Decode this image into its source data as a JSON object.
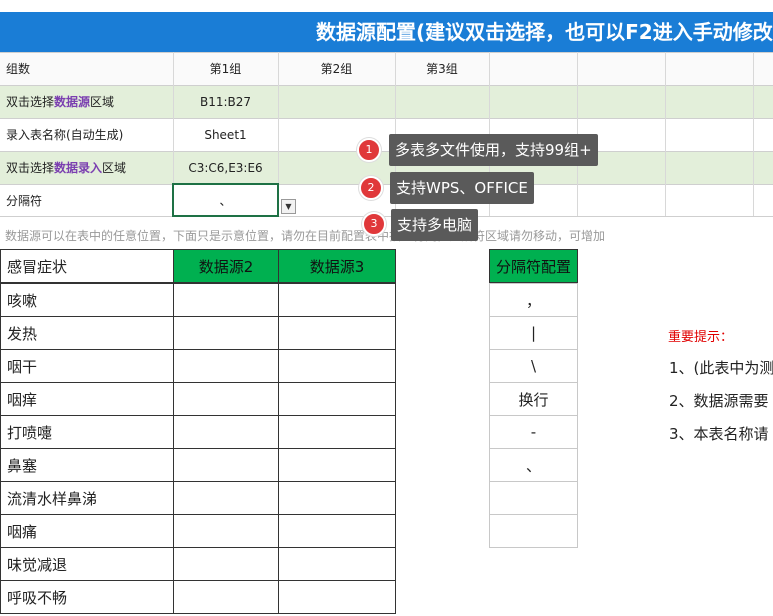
{
  "title": "数据源配置(建议双击选择，也可以F2进入手动修改",
  "config": {
    "header_label": "组数",
    "groups": [
      "第1组",
      "第2组",
      "第3组"
    ],
    "rows": [
      {
        "label_pre": "双击选择",
        "label_em": "数据源",
        "label_post": "区域",
        "value": "B11:B27"
      },
      {
        "label_pre": "录入表名称(自动生成)",
        "label_em": "",
        "label_post": "",
        "value": "Sheet1"
      },
      {
        "label_pre": "双击选择",
        "label_em": "数据录入",
        "label_post": "区域",
        "value": "C3:C6,E3:E6"
      },
      {
        "label_pre": "分隔符",
        "label_em": "",
        "label_post": "",
        "value": "、"
      }
    ],
    "note": "数据源可以在表中的任意位置，下面只是示意位置，请勿在目前配置表中插入行列，分隔符区域请勿移动，可增加"
  },
  "tips": [
    {
      "num": "1",
      "text": "多表多文件使用，支持99组+"
    },
    {
      "num": "2",
      "text": "支持WPS、OFFICE"
    },
    {
      "num": "3",
      "text": "支持多电脑"
    }
  ],
  "symptoms": {
    "header": "感冒症状",
    "items": [
      "咳嗽",
      "发热",
      "咽干",
      "咽痒",
      "打喷嚏",
      "鼻塞",
      "流清水样鼻涕",
      "咽痛",
      "味觉减退",
      "呼吸不畅"
    ]
  },
  "datasource_headers": [
    "数据源2",
    "数据源3"
  ],
  "separator": {
    "header": "分隔符配置",
    "items": [
      "，",
      "|",
      "\\",
      "换行",
      "-",
      "、",
      "",
      ""
    ]
  },
  "hints": {
    "title": "重要提示：",
    "items": [
      "1、(此表中为测",
      "2、数据源需要",
      "3、本表名称请"
    ]
  },
  "colors": {
    "title_bg": "#1a7dd6",
    "green_row": "#e3efda",
    "green_head": "#00b050",
    "tip_bg": "#5a5a5a",
    "dot": "#e0383a",
    "hint_red": "#e00000",
    "purple": "#7b3fb0"
  }
}
